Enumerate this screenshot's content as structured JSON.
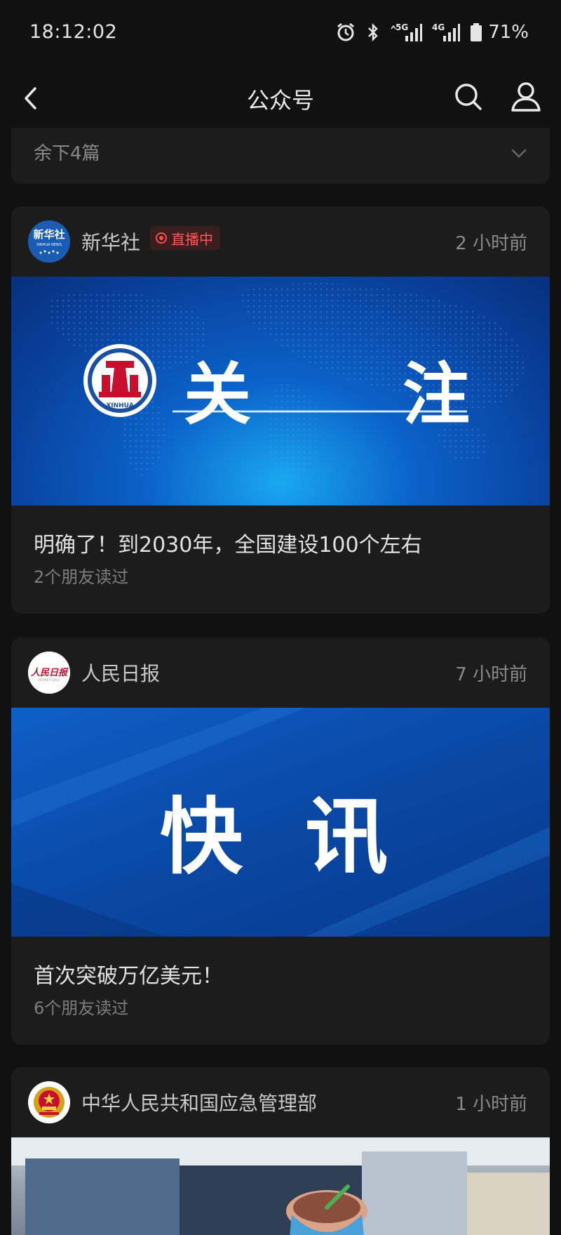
{
  "status_bar": {
    "time": "18:12:02",
    "network_5g": "5G",
    "network_4g": "4G",
    "battery": "71%"
  },
  "nav": {
    "title": "公众号"
  },
  "remaining": {
    "label": "余下4篇"
  },
  "articles": [
    {
      "account": "新华社",
      "live_badge": "直播中",
      "time_ago": "2 小时前",
      "cover_left": "关",
      "cover_right": "注",
      "emblem_text": "XINHUA",
      "avatar_text": "新华社",
      "avatar_subtext": "XINHUA NEWS",
      "title": "明确了！到2030年，全国建设100个左右",
      "reads": "2个朋友读过"
    },
    {
      "account": "人民日报",
      "time_ago": "7 小时前",
      "cover_text": "快 讯",
      "avatar_text": "人民日报",
      "avatar_subtext": "PEOPLE'S DAILY",
      "title": "首次突破万亿美元！",
      "reads": "6个朋友读过"
    },
    {
      "account": "中华人民共和国应急管理部",
      "time_ago": "1 小时前"
    }
  ],
  "colors": {
    "background": "#111111",
    "card": "#1c1c1c",
    "live_red": "#ff5a5a",
    "banner_blue": "#0a4fb0"
  }
}
